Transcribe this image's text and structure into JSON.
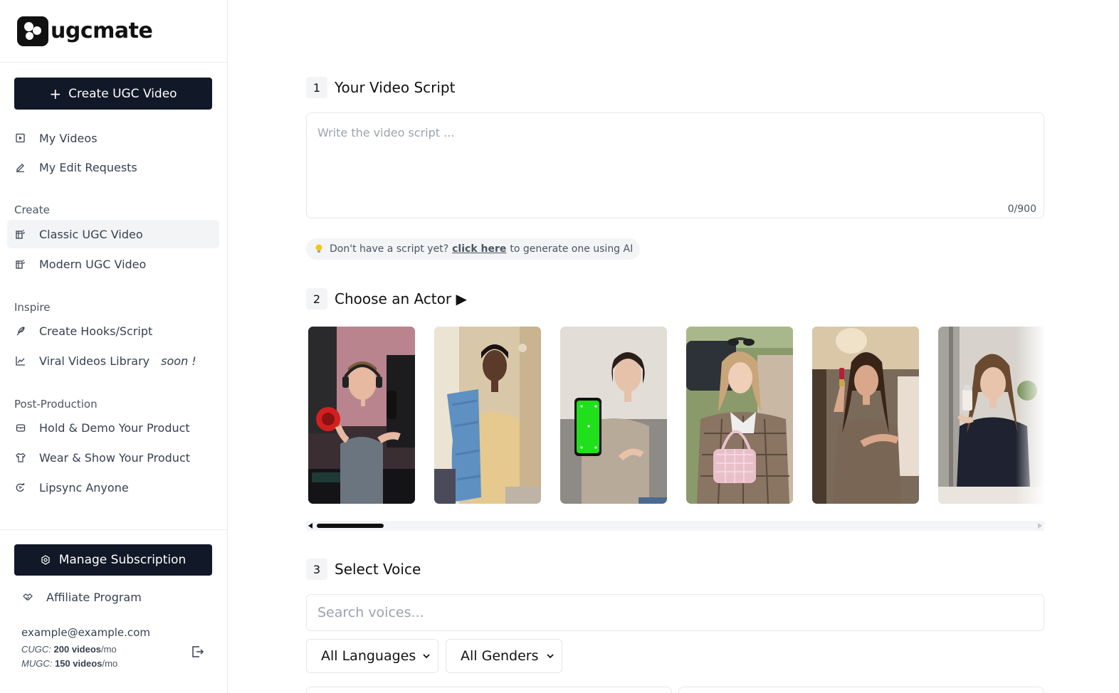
{
  "brand": {
    "name": "ugcmate"
  },
  "sidebar": {
    "create_button": "Create UGC Video",
    "top_items": [
      {
        "label": "My Videos",
        "icon": "play-square-icon"
      },
      {
        "label": "My Edit Requests",
        "icon": "pencil-icon"
      }
    ],
    "sections": {
      "create": {
        "label": "Create",
        "items": [
          {
            "label": "Classic UGC Video",
            "icon": "video-edit-icon",
            "active": true
          },
          {
            "label": "Modern UGC Video",
            "icon": "video-edit-icon"
          }
        ]
      },
      "inspire": {
        "label": "Inspire",
        "items": [
          {
            "label": "Create Hooks/Script",
            "icon": "feather-icon"
          },
          {
            "label": "Viral Videos Library",
            "badge": "soon !",
            "icon": "trend-icon"
          }
        ]
      },
      "post": {
        "label": "Post-Production",
        "items": [
          {
            "label": "Hold & Demo Your Product",
            "icon": "box-icon"
          },
          {
            "label": "Wear & Show Your Product",
            "icon": "shirt-icon"
          },
          {
            "label": "Lipsync Anyone",
            "icon": "lipsync-icon"
          }
        ]
      }
    },
    "manage_button": "Manage Subscription",
    "affiliate": "Affiliate Program",
    "account": {
      "email": "example@example.com",
      "cugc_label": "CUGC:",
      "cugc_value": "200 videos",
      "mugc_label": "MUGC:",
      "mugc_value": "150 videos",
      "per": "/mo"
    }
  },
  "steps": {
    "script": {
      "number": "1",
      "title": "Your Video Script",
      "placeholder": "Write the video script ...",
      "counter": "0/900",
      "hint_before": "Don't have a script yet?",
      "hint_link": "click here",
      "hint_after": "to generate one using AI"
    },
    "actor": {
      "number": "2",
      "title": "Choose an Actor ▶"
    },
    "voice": {
      "number": "3",
      "title": "Select Voice",
      "search_placeholder": "Search voices...",
      "language_select": "All Languages",
      "gender_select": "All Genders"
    }
  },
  "colors": {
    "primary": "#111827",
    "accent_green": "#1fe01a",
    "muted_bg": "#f3f4f6"
  }
}
